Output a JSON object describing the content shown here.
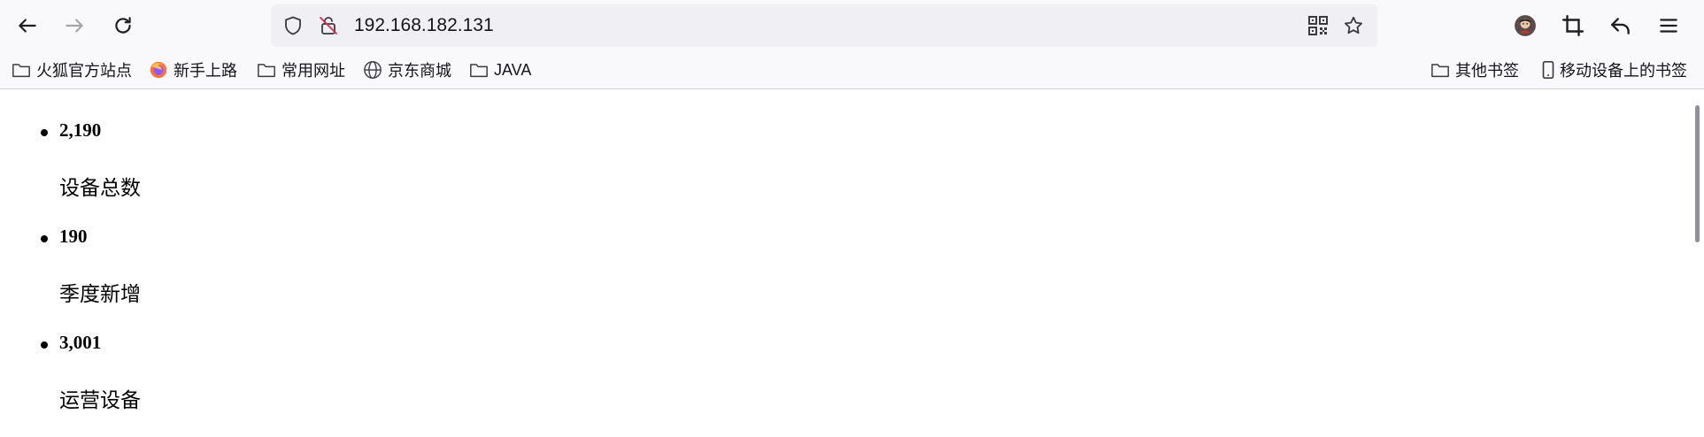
{
  "browser": {
    "url": "192.168.182.131"
  },
  "bookmarks": [
    {
      "label": "火狐官方站点",
      "icon": "folder-icon"
    },
    {
      "label": "新手上路",
      "icon": "firefox-icon"
    },
    {
      "label": "常用网址",
      "icon": "folder-icon"
    },
    {
      "label": "京东商城",
      "icon": "globe-icon"
    },
    {
      "label": "JAVA",
      "icon": "folder-icon"
    }
  ],
  "bookmarks_right": [
    {
      "label": "其他书签",
      "icon": "folder-icon"
    },
    {
      "label": "移动设备上的书签",
      "icon": "mobile-icon"
    }
  ],
  "stats": [
    {
      "value": "2,190",
      "label": "设备总数"
    },
    {
      "value": "190",
      "label": "季度新增"
    },
    {
      "value": "3,001",
      "label": "运营设备"
    }
  ],
  "colors": {
    "toolbar_bg": "#f9f9fb",
    "urlbar_bg": "#f0f0f4",
    "text": "#15141a"
  }
}
